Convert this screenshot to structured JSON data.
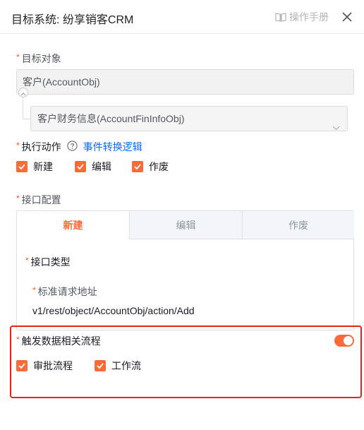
{
  "header": {
    "title": "目标系统: 纷享销客CRM",
    "manual_label": "操作手册"
  },
  "target_object": {
    "label": "目标对象",
    "main_object": "客户(AccountObj)",
    "sub_object": "客户财务信息(AccountFinInfoObj)"
  },
  "actions": {
    "label": "执行动作",
    "link": "事件转换逻辑",
    "options": [
      {
        "label": "新建",
        "checked": true
      },
      {
        "label": "编辑",
        "checked": true
      },
      {
        "label": "作废",
        "checked": true
      }
    ]
  },
  "interface": {
    "label": "接口配置",
    "tabs": [
      "新建",
      "编辑",
      "作废"
    ],
    "active_tab": "新建",
    "type_label": "接口类型",
    "url_label": "标准请求地址",
    "url_value": "v1/rest/object/AccountObj/action/Add"
  },
  "trigger": {
    "label": "触发数据相关流程",
    "toggle_on": true,
    "options": [
      {
        "label": "审批流程",
        "checked": true
      },
      {
        "label": "工作流",
        "checked": true
      }
    ]
  },
  "colors": {
    "accent": "#ff6a39",
    "link": "#0c6cff",
    "required": "#ff522a",
    "highlight_border": "#e1251b"
  }
}
